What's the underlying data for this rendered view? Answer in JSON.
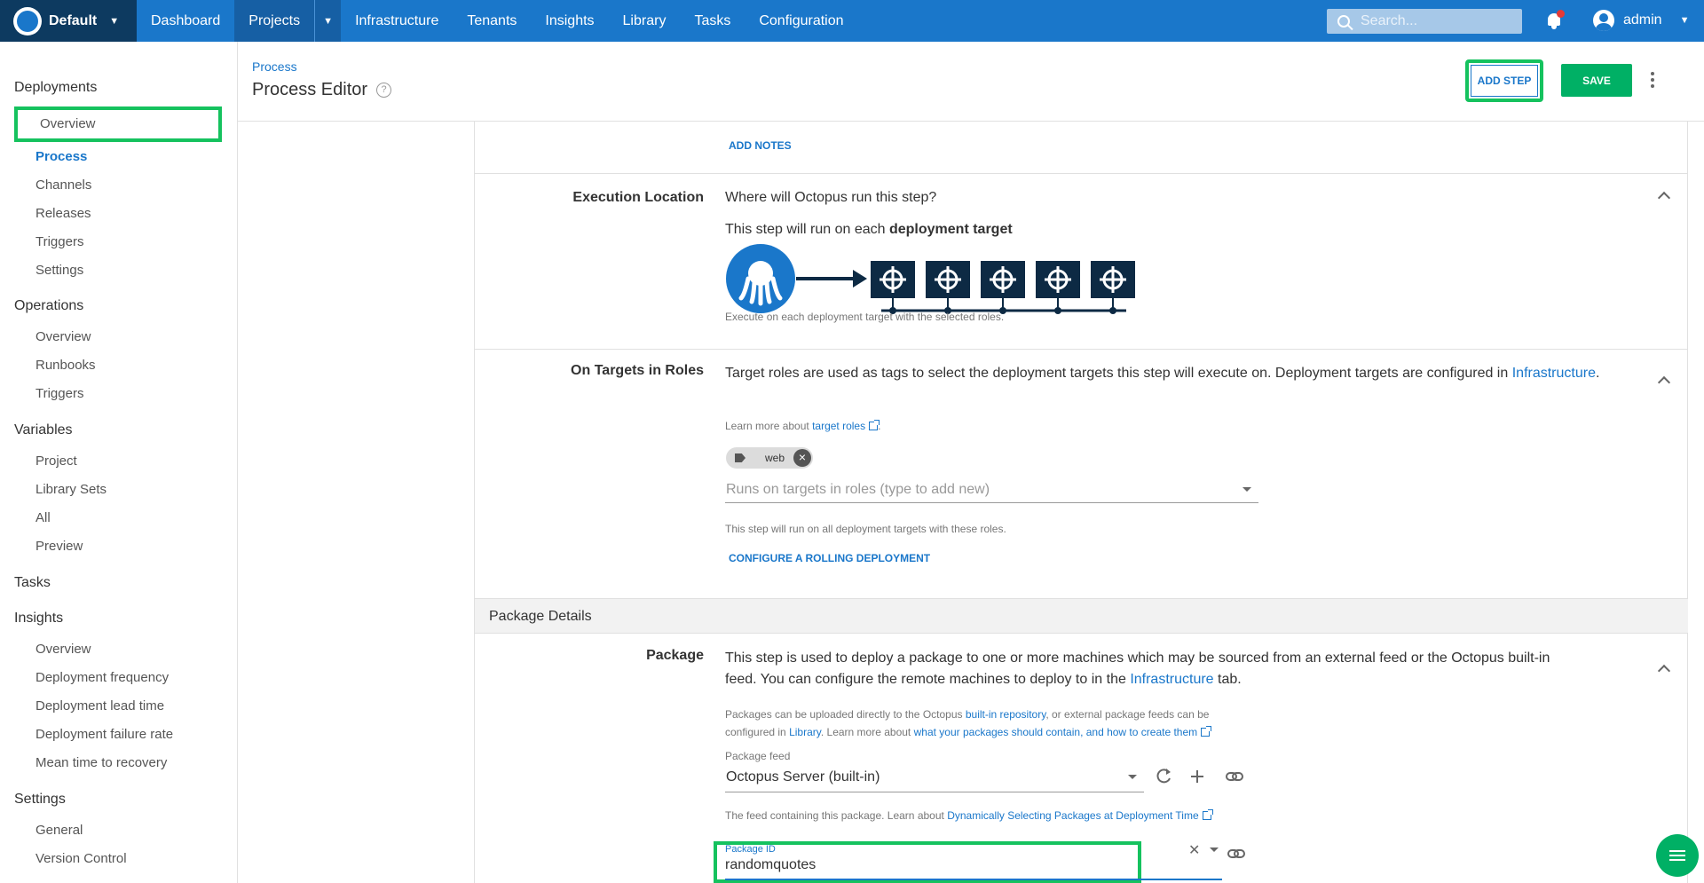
{
  "topnav": {
    "space": "Default",
    "items": [
      "Dashboard",
      "Projects",
      "Infrastructure",
      "Tenants",
      "Insights",
      "Library",
      "Tasks",
      "Configuration"
    ],
    "active": "Projects",
    "search_placeholder": "Search...",
    "user": "admin"
  },
  "sidebar": {
    "deployments": {
      "title": "Deployments",
      "items": [
        "Overview",
        "Process",
        "Channels",
        "Releases",
        "Triggers",
        "Settings"
      ]
    },
    "operations": {
      "title": "Operations",
      "items": [
        "Overview",
        "Runbooks",
        "Triggers"
      ]
    },
    "variables": {
      "title": "Variables",
      "items": [
        "Project",
        "Library Sets",
        "All",
        "Preview"
      ]
    },
    "tasks": {
      "title": "Tasks"
    },
    "insights": {
      "title": "Insights",
      "items": [
        "Overview",
        "Deployment frequency",
        "Deployment lead time",
        "Deployment failure rate",
        "Mean time to recovery"
      ]
    },
    "settings": {
      "title": "Settings",
      "items": [
        "General",
        "Version Control"
      ]
    }
  },
  "header": {
    "breadcrumb": "Process",
    "title": "Process Editor",
    "add_step": "ADD STEP",
    "save": "SAVE"
  },
  "content": {
    "add_notes": "ADD NOTES",
    "execution": {
      "label": "Execution Location",
      "question": "Where will Octopus run this step?",
      "desc_prefix": "This step will run on each",
      "desc_bold": "deployment target",
      "caption": "Execute on each deployment target with the selected roles."
    },
    "roles": {
      "label": "On Targets in Roles",
      "desc": "Target roles are used as tags to select the deployment targets this step will execute on. Deployment targets are configured in",
      "desc_link": "Infrastructure",
      "desc_end": ".",
      "learn_prefix": "Learn more about",
      "learn_link": "target roles",
      "learn_end": ".",
      "tag": "web",
      "placeholder": "Runs on targets in roles (type to add new)",
      "hint": "This step will run on all deployment targets with these roles.",
      "rolling": "CONFIGURE A ROLLING DEPLOYMENT"
    },
    "package_details": "Package Details",
    "package": {
      "label": "Package",
      "desc1": "This step is used to deploy a package to one or more machines which may be sourced from an external feed or the Octopus built-in",
      "desc2_prefix": "feed. You can configure the remote machines to deploy to in the",
      "desc2_link": "Infrastructure",
      "desc2_end": "tab.",
      "info1_prefix": "Packages can be uploaded directly to the Octopus",
      "info1_link": "built-in repository",
      "info1_end": ", or external package feeds can be",
      "info2_prefix": "configured in",
      "info2_link1": "Library",
      "info2_mid": ". Learn more about",
      "info2_link2": "what your packages should contain, and how to create them",
      "feed_label": "Package feed",
      "feed_value": "Octopus Server (built-in)",
      "feed_hint_prefix": "The feed containing this package. Learn about",
      "feed_hint_link": "Dynamically Selecting Packages at Deployment Time",
      "id_label": "Package ID",
      "id_value": "randomquotes"
    }
  },
  "colors": {
    "brand": "#1a77ca",
    "save": "#00b065",
    "highlight": "#15c25e"
  }
}
